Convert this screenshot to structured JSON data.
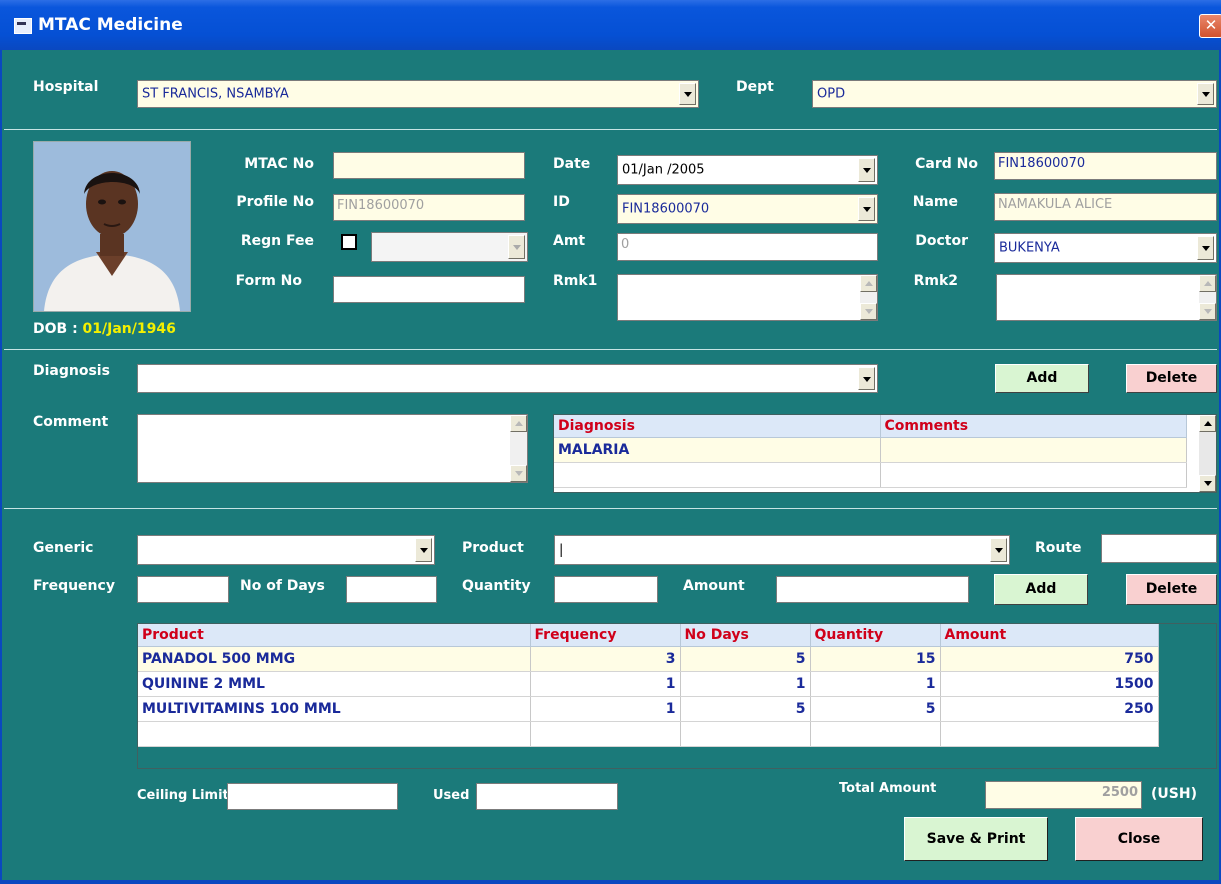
{
  "window": {
    "title": "MTAC Medicine",
    "close_glyph": "✕"
  },
  "hospital": {
    "label": "Hospital",
    "value": "ST FRANCIS, NSAMBYA"
  },
  "dept": {
    "label": "Dept",
    "value": "OPD"
  },
  "patient": {
    "dob_label": "DOB : ",
    "dob_value": "01/Jan/1946",
    "mtac_no": {
      "label": "MTAC No",
      "value": ""
    },
    "profile_no": {
      "label": "Profile No",
      "value": "FIN18600070"
    },
    "regn_fee": {
      "label": "Regn Fee",
      "checked": false,
      "value": ""
    },
    "form_no": {
      "label": "Form No",
      "value": ""
    },
    "date": {
      "label": "Date",
      "value": "01/Jan /2005"
    },
    "id": {
      "label": "ID",
      "value": "FIN18600070"
    },
    "amt": {
      "label": "Amt",
      "value": "0"
    },
    "rmk1": {
      "label": "Rmk1",
      "value": ""
    },
    "card_no": {
      "label": "Card No",
      "value": "FIN18600070"
    },
    "name": {
      "label": "Name",
      "value": "NAMAKULA ALICE"
    },
    "doctor": {
      "label": "Doctor",
      "value": "BUKENYA"
    },
    "rmk2": {
      "label": "Rmk2",
      "value": ""
    }
  },
  "diagnosis_section": {
    "diagnosis_label": "Diagnosis",
    "diagnosis_value": "",
    "comment_label": "Comment",
    "comment_value": "",
    "add_label": "Add",
    "delete_label": "Delete",
    "grid": {
      "headers": [
        "Diagnosis",
        "Comments"
      ],
      "rows": [
        [
          "MALARIA",
          ""
        ],
        [
          "",
          ""
        ]
      ]
    }
  },
  "prescription": {
    "generic_label": "Generic",
    "generic_value": "",
    "product_label": "Product",
    "product_value": "|",
    "route_label": "Route",
    "route_value": "",
    "frequency_label": "Frequency",
    "frequency_value": "",
    "no_of_days_label": "No of Days",
    "no_of_days_value": "",
    "quantity_label": "Quantity",
    "quantity_value": "",
    "amount_label": "Amount",
    "amount_value": "",
    "add_label": "Add",
    "delete_label": "Delete",
    "grid": {
      "headers": [
        "Product",
        "Frequency",
        "No Days",
        "Quantity",
        "Amount"
      ],
      "rows": [
        [
          "PANADOL  500 MMG",
          "3",
          "5",
          "15",
          "750"
        ],
        [
          "QUININE  2 MML",
          "1",
          "1",
          "1",
          "1500"
        ],
        [
          "MULTIVITAMINS  100 MML",
          "1",
          "5",
          "5",
          "250"
        ],
        [
          "",
          "",
          "",
          "",
          ""
        ]
      ]
    }
  },
  "footer": {
    "ceiling_limit_label": "Ceiling Limit",
    "ceiling_limit_value": "",
    "used_label": "Used",
    "used_value": "",
    "total_amount_label": "Total Amount",
    "total_amount_value": "2500",
    "currency": "(USH)",
    "save_label": "Save & Print",
    "close_label": "Close"
  },
  "colors": {
    "form_bg": "#1b7a7a",
    "titlebar": "#0550d4",
    "header_text": "#d0001a",
    "cell_text": "#1a2a9a",
    "dob_value": "#f4f000"
  }
}
